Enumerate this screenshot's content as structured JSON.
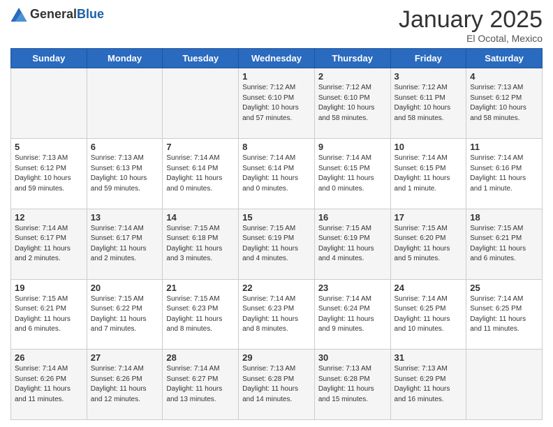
{
  "header": {
    "logo_general": "General",
    "logo_blue": "Blue",
    "month_year": "January 2025",
    "location": "El Ocotal, Mexico"
  },
  "weekdays": [
    "Sunday",
    "Monday",
    "Tuesday",
    "Wednesday",
    "Thursday",
    "Friday",
    "Saturday"
  ],
  "weeks": [
    [
      {
        "day": "",
        "info": ""
      },
      {
        "day": "",
        "info": ""
      },
      {
        "day": "",
        "info": ""
      },
      {
        "day": "1",
        "info": "Sunrise: 7:12 AM\nSunset: 6:10 PM\nDaylight: 10 hours\nand 57 minutes."
      },
      {
        "day": "2",
        "info": "Sunrise: 7:12 AM\nSunset: 6:10 PM\nDaylight: 10 hours\nand 58 minutes."
      },
      {
        "day": "3",
        "info": "Sunrise: 7:12 AM\nSunset: 6:11 PM\nDaylight: 10 hours\nand 58 minutes."
      },
      {
        "day": "4",
        "info": "Sunrise: 7:13 AM\nSunset: 6:12 PM\nDaylight: 10 hours\nand 58 minutes."
      }
    ],
    [
      {
        "day": "5",
        "info": "Sunrise: 7:13 AM\nSunset: 6:12 PM\nDaylight: 10 hours\nand 59 minutes."
      },
      {
        "day": "6",
        "info": "Sunrise: 7:13 AM\nSunset: 6:13 PM\nDaylight: 10 hours\nand 59 minutes."
      },
      {
        "day": "7",
        "info": "Sunrise: 7:14 AM\nSunset: 6:14 PM\nDaylight: 11 hours\nand 0 minutes."
      },
      {
        "day": "8",
        "info": "Sunrise: 7:14 AM\nSunset: 6:14 PM\nDaylight: 11 hours\nand 0 minutes."
      },
      {
        "day": "9",
        "info": "Sunrise: 7:14 AM\nSunset: 6:15 PM\nDaylight: 11 hours\nand 0 minutes."
      },
      {
        "day": "10",
        "info": "Sunrise: 7:14 AM\nSunset: 6:15 PM\nDaylight: 11 hours\nand 1 minute."
      },
      {
        "day": "11",
        "info": "Sunrise: 7:14 AM\nSunset: 6:16 PM\nDaylight: 11 hours\nand 1 minute."
      }
    ],
    [
      {
        "day": "12",
        "info": "Sunrise: 7:14 AM\nSunset: 6:17 PM\nDaylight: 11 hours\nand 2 minutes."
      },
      {
        "day": "13",
        "info": "Sunrise: 7:14 AM\nSunset: 6:17 PM\nDaylight: 11 hours\nand 2 minutes."
      },
      {
        "day": "14",
        "info": "Sunrise: 7:15 AM\nSunset: 6:18 PM\nDaylight: 11 hours\nand 3 minutes."
      },
      {
        "day": "15",
        "info": "Sunrise: 7:15 AM\nSunset: 6:19 PM\nDaylight: 11 hours\nand 4 minutes."
      },
      {
        "day": "16",
        "info": "Sunrise: 7:15 AM\nSunset: 6:19 PM\nDaylight: 11 hours\nand 4 minutes."
      },
      {
        "day": "17",
        "info": "Sunrise: 7:15 AM\nSunset: 6:20 PM\nDaylight: 11 hours\nand 5 minutes."
      },
      {
        "day": "18",
        "info": "Sunrise: 7:15 AM\nSunset: 6:21 PM\nDaylight: 11 hours\nand 6 minutes."
      }
    ],
    [
      {
        "day": "19",
        "info": "Sunrise: 7:15 AM\nSunset: 6:21 PM\nDaylight: 11 hours\nand 6 minutes."
      },
      {
        "day": "20",
        "info": "Sunrise: 7:15 AM\nSunset: 6:22 PM\nDaylight: 11 hours\nand 7 minutes."
      },
      {
        "day": "21",
        "info": "Sunrise: 7:15 AM\nSunset: 6:23 PM\nDaylight: 11 hours\nand 8 minutes."
      },
      {
        "day": "22",
        "info": "Sunrise: 7:14 AM\nSunset: 6:23 PM\nDaylight: 11 hours\nand 8 minutes."
      },
      {
        "day": "23",
        "info": "Sunrise: 7:14 AM\nSunset: 6:24 PM\nDaylight: 11 hours\nand 9 minutes."
      },
      {
        "day": "24",
        "info": "Sunrise: 7:14 AM\nSunset: 6:25 PM\nDaylight: 11 hours\nand 10 minutes."
      },
      {
        "day": "25",
        "info": "Sunrise: 7:14 AM\nSunset: 6:25 PM\nDaylight: 11 hours\nand 11 minutes."
      }
    ],
    [
      {
        "day": "26",
        "info": "Sunrise: 7:14 AM\nSunset: 6:26 PM\nDaylight: 11 hours\nand 11 minutes."
      },
      {
        "day": "27",
        "info": "Sunrise: 7:14 AM\nSunset: 6:26 PM\nDaylight: 11 hours\nand 12 minutes."
      },
      {
        "day": "28",
        "info": "Sunrise: 7:14 AM\nSunset: 6:27 PM\nDaylight: 11 hours\nand 13 minutes."
      },
      {
        "day": "29",
        "info": "Sunrise: 7:13 AM\nSunset: 6:28 PM\nDaylight: 11 hours\nand 14 minutes."
      },
      {
        "day": "30",
        "info": "Sunrise: 7:13 AM\nSunset: 6:28 PM\nDaylight: 11 hours\nand 15 minutes."
      },
      {
        "day": "31",
        "info": "Sunrise: 7:13 AM\nSunset: 6:29 PM\nDaylight: 11 hours\nand 16 minutes."
      },
      {
        "day": "",
        "info": ""
      }
    ]
  ]
}
